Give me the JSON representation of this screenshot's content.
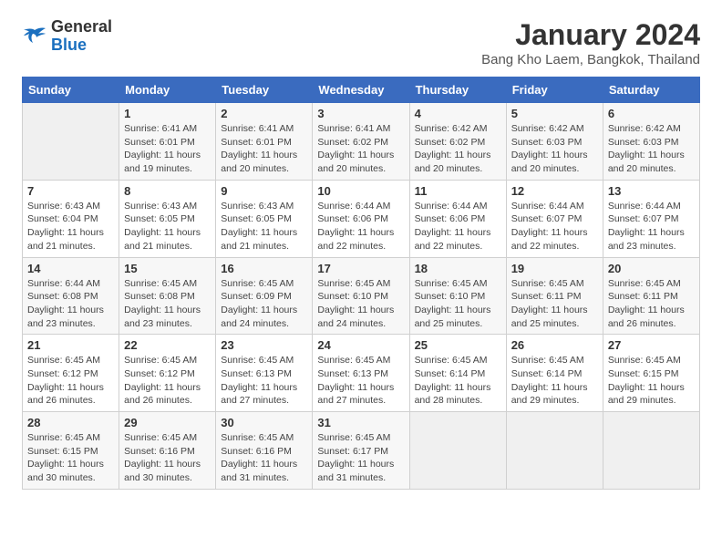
{
  "logo": {
    "general": "General",
    "blue": "Blue"
  },
  "header": {
    "title": "January 2024",
    "subtitle": "Bang Kho Laem, Bangkok, Thailand"
  },
  "weekdays": [
    "Sunday",
    "Monday",
    "Tuesday",
    "Wednesday",
    "Thursday",
    "Friday",
    "Saturday"
  ],
  "weeks": [
    [
      {
        "day": "",
        "sunrise": "",
        "sunset": "",
        "daylight": ""
      },
      {
        "day": "1",
        "sunrise": "Sunrise: 6:41 AM",
        "sunset": "Sunset: 6:01 PM",
        "daylight": "Daylight: 11 hours and 19 minutes."
      },
      {
        "day": "2",
        "sunrise": "Sunrise: 6:41 AM",
        "sunset": "Sunset: 6:01 PM",
        "daylight": "Daylight: 11 hours and 20 minutes."
      },
      {
        "day": "3",
        "sunrise": "Sunrise: 6:41 AM",
        "sunset": "Sunset: 6:02 PM",
        "daylight": "Daylight: 11 hours and 20 minutes."
      },
      {
        "day": "4",
        "sunrise": "Sunrise: 6:42 AM",
        "sunset": "Sunset: 6:02 PM",
        "daylight": "Daylight: 11 hours and 20 minutes."
      },
      {
        "day": "5",
        "sunrise": "Sunrise: 6:42 AM",
        "sunset": "Sunset: 6:03 PM",
        "daylight": "Daylight: 11 hours and 20 minutes."
      },
      {
        "day": "6",
        "sunrise": "Sunrise: 6:42 AM",
        "sunset": "Sunset: 6:03 PM",
        "daylight": "Daylight: 11 hours and 20 minutes."
      }
    ],
    [
      {
        "day": "7",
        "sunrise": "Sunrise: 6:43 AM",
        "sunset": "Sunset: 6:04 PM",
        "daylight": "Daylight: 11 hours and 21 minutes."
      },
      {
        "day": "8",
        "sunrise": "Sunrise: 6:43 AM",
        "sunset": "Sunset: 6:05 PM",
        "daylight": "Daylight: 11 hours and 21 minutes."
      },
      {
        "day": "9",
        "sunrise": "Sunrise: 6:43 AM",
        "sunset": "Sunset: 6:05 PM",
        "daylight": "Daylight: 11 hours and 21 minutes."
      },
      {
        "day": "10",
        "sunrise": "Sunrise: 6:44 AM",
        "sunset": "Sunset: 6:06 PM",
        "daylight": "Daylight: 11 hours and 22 minutes."
      },
      {
        "day": "11",
        "sunrise": "Sunrise: 6:44 AM",
        "sunset": "Sunset: 6:06 PM",
        "daylight": "Daylight: 11 hours and 22 minutes."
      },
      {
        "day": "12",
        "sunrise": "Sunrise: 6:44 AM",
        "sunset": "Sunset: 6:07 PM",
        "daylight": "Daylight: 11 hours and 22 minutes."
      },
      {
        "day": "13",
        "sunrise": "Sunrise: 6:44 AM",
        "sunset": "Sunset: 6:07 PM",
        "daylight": "Daylight: 11 hours and 23 minutes."
      }
    ],
    [
      {
        "day": "14",
        "sunrise": "Sunrise: 6:44 AM",
        "sunset": "Sunset: 6:08 PM",
        "daylight": "Daylight: 11 hours and 23 minutes."
      },
      {
        "day": "15",
        "sunrise": "Sunrise: 6:45 AM",
        "sunset": "Sunset: 6:08 PM",
        "daylight": "Daylight: 11 hours and 23 minutes."
      },
      {
        "day": "16",
        "sunrise": "Sunrise: 6:45 AM",
        "sunset": "Sunset: 6:09 PM",
        "daylight": "Daylight: 11 hours and 24 minutes."
      },
      {
        "day": "17",
        "sunrise": "Sunrise: 6:45 AM",
        "sunset": "Sunset: 6:10 PM",
        "daylight": "Daylight: 11 hours and 24 minutes."
      },
      {
        "day": "18",
        "sunrise": "Sunrise: 6:45 AM",
        "sunset": "Sunset: 6:10 PM",
        "daylight": "Daylight: 11 hours and 25 minutes."
      },
      {
        "day": "19",
        "sunrise": "Sunrise: 6:45 AM",
        "sunset": "Sunset: 6:11 PM",
        "daylight": "Daylight: 11 hours and 25 minutes."
      },
      {
        "day": "20",
        "sunrise": "Sunrise: 6:45 AM",
        "sunset": "Sunset: 6:11 PM",
        "daylight": "Daylight: 11 hours and 26 minutes."
      }
    ],
    [
      {
        "day": "21",
        "sunrise": "Sunrise: 6:45 AM",
        "sunset": "Sunset: 6:12 PM",
        "daylight": "Daylight: 11 hours and 26 minutes."
      },
      {
        "day": "22",
        "sunrise": "Sunrise: 6:45 AM",
        "sunset": "Sunset: 6:12 PM",
        "daylight": "Daylight: 11 hours and 26 minutes."
      },
      {
        "day": "23",
        "sunrise": "Sunrise: 6:45 AM",
        "sunset": "Sunset: 6:13 PM",
        "daylight": "Daylight: 11 hours and 27 minutes."
      },
      {
        "day": "24",
        "sunrise": "Sunrise: 6:45 AM",
        "sunset": "Sunset: 6:13 PM",
        "daylight": "Daylight: 11 hours and 27 minutes."
      },
      {
        "day": "25",
        "sunrise": "Sunrise: 6:45 AM",
        "sunset": "Sunset: 6:14 PM",
        "daylight": "Daylight: 11 hours and 28 minutes."
      },
      {
        "day": "26",
        "sunrise": "Sunrise: 6:45 AM",
        "sunset": "Sunset: 6:14 PM",
        "daylight": "Daylight: 11 hours and 29 minutes."
      },
      {
        "day": "27",
        "sunrise": "Sunrise: 6:45 AM",
        "sunset": "Sunset: 6:15 PM",
        "daylight": "Daylight: 11 hours and 29 minutes."
      }
    ],
    [
      {
        "day": "28",
        "sunrise": "Sunrise: 6:45 AM",
        "sunset": "Sunset: 6:15 PM",
        "daylight": "Daylight: 11 hours and 30 minutes."
      },
      {
        "day": "29",
        "sunrise": "Sunrise: 6:45 AM",
        "sunset": "Sunset: 6:16 PM",
        "daylight": "Daylight: 11 hours and 30 minutes."
      },
      {
        "day": "30",
        "sunrise": "Sunrise: 6:45 AM",
        "sunset": "Sunset: 6:16 PM",
        "daylight": "Daylight: 11 hours and 31 minutes."
      },
      {
        "day": "31",
        "sunrise": "Sunrise: 6:45 AM",
        "sunset": "Sunset: 6:17 PM",
        "daylight": "Daylight: 11 hours and 31 minutes."
      },
      {
        "day": "",
        "sunrise": "",
        "sunset": "",
        "daylight": ""
      },
      {
        "day": "",
        "sunrise": "",
        "sunset": "",
        "daylight": ""
      },
      {
        "day": "",
        "sunrise": "",
        "sunset": "",
        "daylight": ""
      }
    ]
  ]
}
